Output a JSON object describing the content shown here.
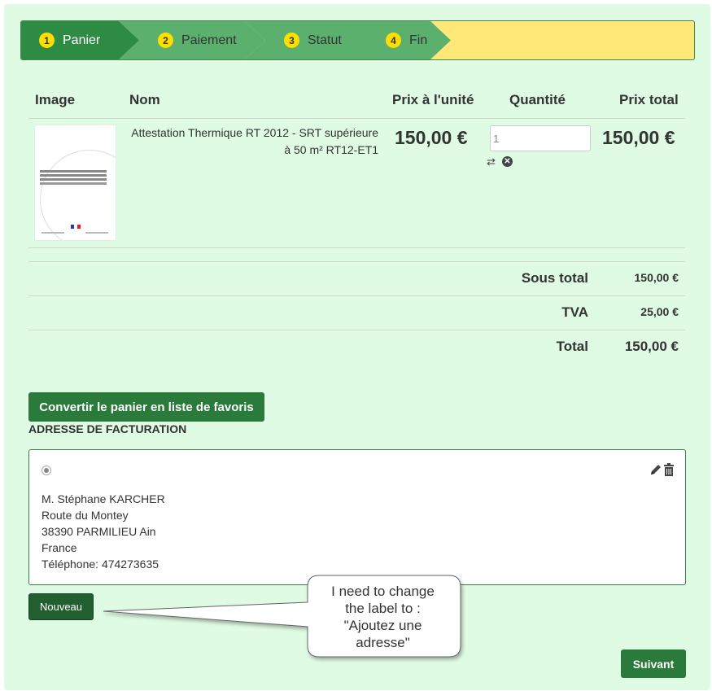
{
  "stepper": {
    "steps": [
      {
        "num": "1",
        "label": "Panier"
      },
      {
        "num": "2",
        "label": "Paiement"
      },
      {
        "num": "3",
        "label": "Statut"
      },
      {
        "num": "4",
        "label": "Fin"
      }
    ]
  },
  "cart": {
    "headers": {
      "image": "Image",
      "name": "Nom",
      "unit_price": "Prix à l'unité",
      "quantity": "Quantité",
      "total_price": "Prix total"
    },
    "item": {
      "name": "Attestation Thermique RT 2012 - SRT supérieure à 50 m² RT12-ET1",
      "unit_price": "150,00 €",
      "quantity": "1",
      "total_price": "150,00 €"
    },
    "summary": {
      "subtotal_label": "Sous total",
      "subtotal": "150,00 €",
      "tax_label": "TVA",
      "tax": "25,00 €",
      "total_label": "Total",
      "total": "150,00 €"
    }
  },
  "convert_button": "Convertir le panier en liste de favoris",
  "billing": {
    "title": "ADRESSE DE FACTURATION",
    "address": {
      "name": "M. Stéphane KARCHER",
      "street": "Route du Montey",
      "city": "38390 PARMILIEU Ain",
      "country": "France",
      "phone": "Téléphone: 474273635"
    },
    "new_button": "Nouveau"
  },
  "callout": {
    "line1": "I need to change",
    "line2": "the label to :",
    "line3": "\"Ajoutez une",
    "line4": "adresse\""
  },
  "next_button": "Suivant",
  "colors": {
    "primary": "#2a7a3c",
    "background": "#dffbe3",
    "highlight": "#ffe877"
  }
}
